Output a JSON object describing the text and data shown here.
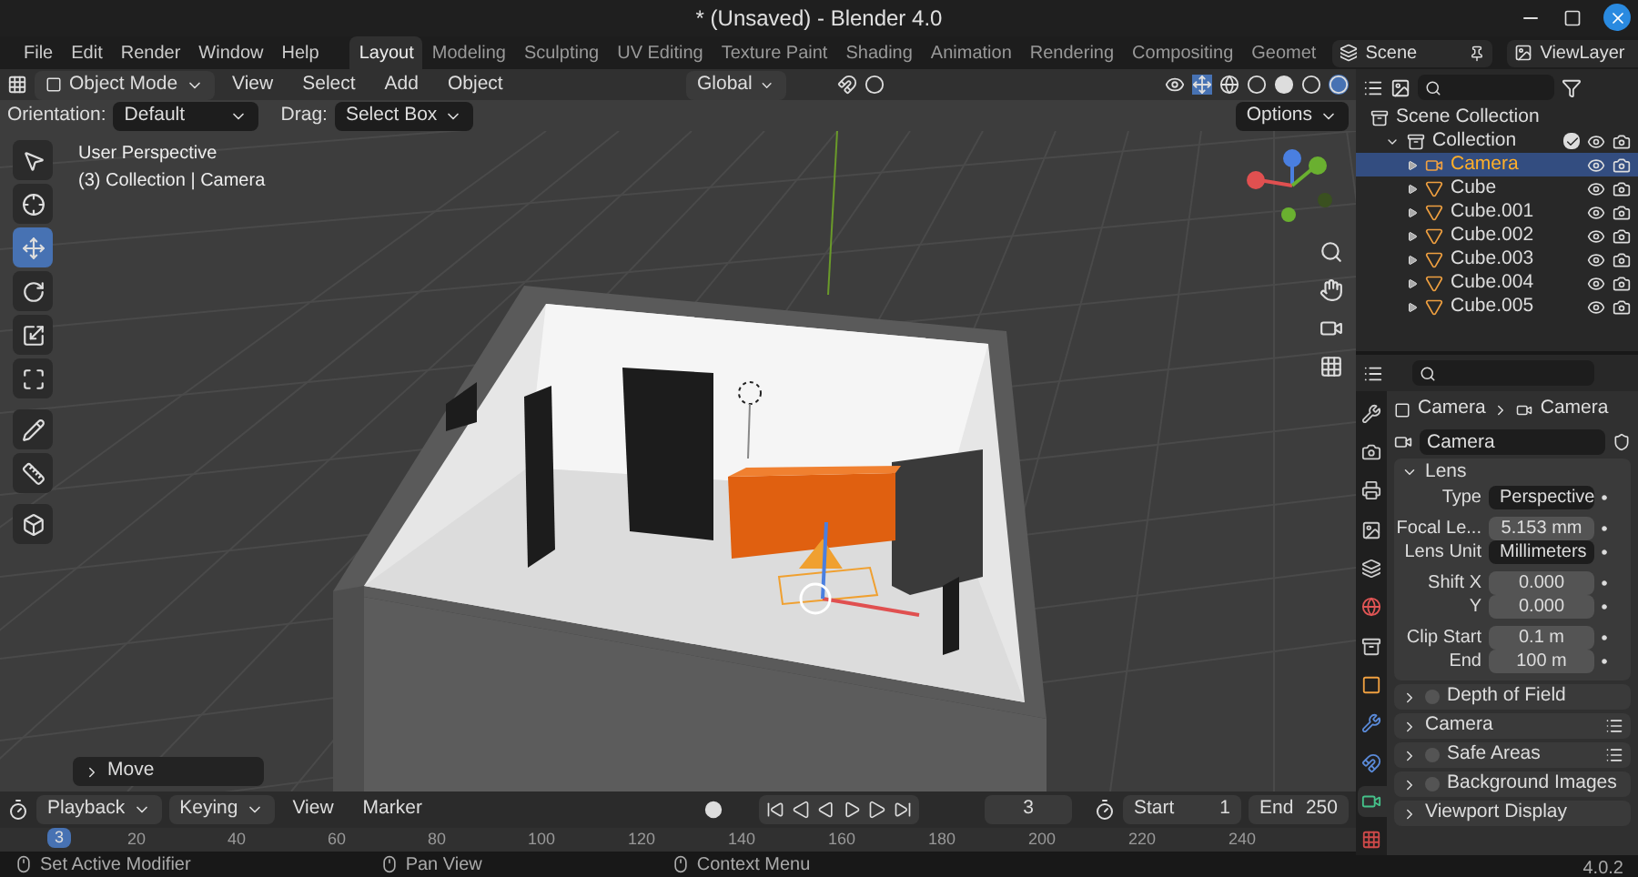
{
  "window": {
    "title": "* (Unsaved) - Blender 4.0"
  },
  "menu": [
    "File",
    "Edit",
    "Render",
    "Window",
    "Help"
  ],
  "workspaces": [
    {
      "label": "Layout",
      "selected": true
    },
    {
      "label": "Modeling",
      "selected": false
    },
    {
      "label": "Sculpting",
      "selected": false
    },
    {
      "label": "UV Editing",
      "selected": false
    },
    {
      "label": "Texture Paint",
      "selected": false
    },
    {
      "label": "Shading",
      "selected": false
    },
    {
      "label": "Animation",
      "selected": false
    },
    {
      "label": "Rendering",
      "selected": false
    },
    {
      "label": "Compositing",
      "selected": false
    },
    {
      "label": "Geomet",
      "selected": false
    }
  ],
  "scene": "Scene",
  "view_layer": "ViewLayer",
  "viewport_header": {
    "mode": "Object Mode",
    "menus": [
      "View",
      "Select",
      "Add",
      "Object"
    ],
    "orientation": "Global"
  },
  "tool_settings": {
    "orientation_label": "Orientation:",
    "orientation": "Default",
    "drag_label": "Drag:",
    "drag": "Select Box",
    "options": "Options"
  },
  "viewport": {
    "overlay": [
      "User Perspective",
      "(3) Collection | Camera"
    ],
    "last_operation": "Move"
  },
  "toolbar": [
    {
      "kind": "select",
      "selected": false
    },
    {
      "kind": "cursor",
      "selected": false
    },
    {
      "kind": "move",
      "selected": true
    },
    {
      "kind": "rotate",
      "selected": false
    },
    {
      "kind": "scale",
      "selected": false
    },
    {
      "kind": "transform",
      "selected": false
    },
    {
      "kind": "annotate",
      "selected": false
    },
    {
      "kind": "measure",
      "selected": false
    },
    {
      "kind": "add",
      "selected": false
    }
  ],
  "outliner": {
    "root": "Scene Collection",
    "collection": {
      "name": "Collection",
      "expanded": true,
      "checked": true,
      "children": [
        {
          "name": "Camera",
          "kind": "camera",
          "selected": true
        },
        {
          "name": "Cube",
          "kind": "mesh",
          "selected": false
        },
        {
          "name": "Cube.001",
          "kind": "mesh",
          "selected": false
        },
        {
          "name": "Cube.002",
          "kind": "mesh",
          "selected": false
        },
        {
          "name": "Cube.003",
          "kind": "mesh",
          "selected": false
        },
        {
          "name": "Cube.004",
          "kind": "mesh",
          "selected": false
        },
        {
          "name": "Cube.005",
          "kind": "mesh",
          "selected": false
        }
      ]
    }
  },
  "properties": {
    "tabs": [
      {
        "kind": "tool",
        "selected": false
      },
      {
        "kind": "render",
        "selected": false
      },
      {
        "kind": "output",
        "selected": false
      },
      {
        "kind": "view_layer",
        "selected": false
      },
      {
        "kind": "scene",
        "selected": false
      },
      {
        "kind": "world",
        "selected": false
      },
      {
        "kind": "collection",
        "selected": false
      },
      {
        "kind": "object",
        "selected": false
      },
      {
        "kind": "modifiers",
        "selected": false
      },
      {
        "kind": "constraints",
        "selected": false
      },
      {
        "kind": "data",
        "selected": true
      },
      {
        "kind": "texture",
        "selected": false
      }
    ],
    "breadcrumb": [
      "Camera",
      "Camera"
    ],
    "datablock": "Camera",
    "lens": {
      "title": "Lens",
      "expanded": true,
      "fields": [
        {
          "label": "Type",
          "value": "Perspective",
          "kind": "dropdown"
        },
        {
          "label": "Focal Le...",
          "value": "5.153 mm",
          "kind": "number"
        },
        {
          "label": "Lens Unit",
          "value": "Millimeters",
          "kind": "dropdown"
        },
        {
          "label": "Shift X",
          "value": "0.000",
          "kind": "number"
        },
        {
          "label": "Y",
          "value": "0.000",
          "kind": "number"
        },
        {
          "label": "Clip Start",
          "value": "0.1 m",
          "kind": "number"
        },
        {
          "label": "End",
          "value": "100 m",
          "kind": "number"
        }
      ]
    },
    "panels": [
      {
        "title": "Depth of Field",
        "kind": "checkbox",
        "checked": false,
        "presets": false
      },
      {
        "title": "Camera",
        "kind": "plain",
        "presets": true
      },
      {
        "title": "Safe Areas",
        "kind": "checkbox",
        "checked": false,
        "presets": true
      },
      {
        "title": "Background Images",
        "kind": "checkbox",
        "checked": false,
        "presets": false
      },
      {
        "title": "Viewport Display",
        "kind": "plain",
        "presets": false
      }
    ]
  },
  "timeline": {
    "menus": [
      "Playback",
      "Keying",
      "View",
      "Marker"
    ],
    "current_frame": "3",
    "start_label": "Start",
    "start": "1",
    "end_label": "End",
    "end": "250",
    "playhead": "3",
    "ticks": [
      "20",
      "40",
      "60",
      "80",
      "100",
      "120",
      "140",
      "160",
      "180",
      "200",
      "220",
      "240"
    ]
  },
  "status_bar": [
    "Set Active Modifier",
    "Pan View",
    "Context Menu"
  ],
  "version": "4.0.2"
}
